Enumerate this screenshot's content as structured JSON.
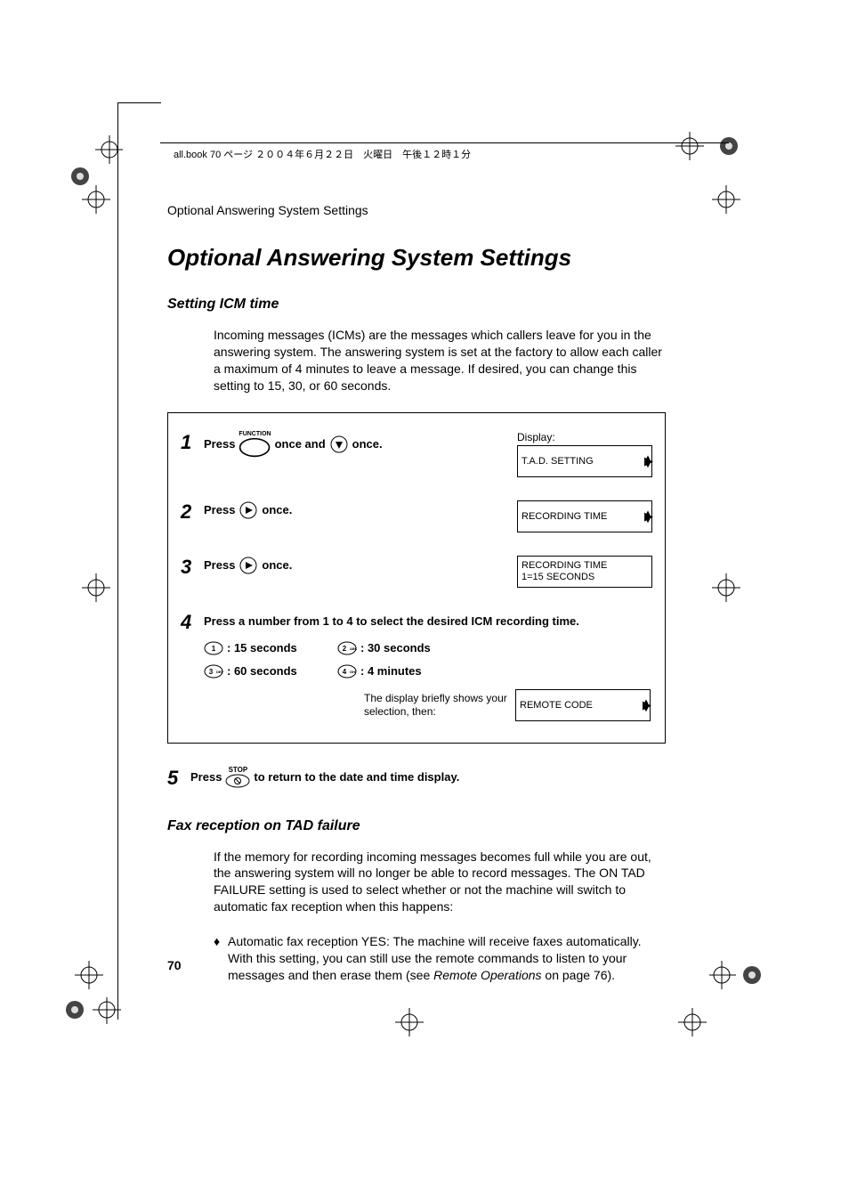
{
  "header": {
    "running_head": "Optional Answering System Settings",
    "book_line": "all.book  70 ページ  ２００４年６月２２日　火曜日　午後１２時１分"
  },
  "title": "Optional Answering System Settings",
  "section1": {
    "heading": "Setting ICM time",
    "para": "Incoming messages (ICMs) are the messages which callers leave for you in the answering system. The answering system is set at the factory to allow each caller a maximum of 4 minutes to leave a message. If desired, you can change this setting to 15, 30, or 60 seconds."
  },
  "steps": {
    "display_label": "Display:",
    "s1": {
      "num": "1",
      "press": "Press",
      "once_and": " once and ",
      "once": " once.",
      "display": "T.A.D. SETTING"
    },
    "s2": {
      "num": "2",
      "press": "Press ",
      "once": " once.",
      "display": "RECORDING TIME"
    },
    "s3": {
      "num": "3",
      "press": "Press ",
      "once": " once.",
      "display_l1": "RECORDING TIME",
      "display_l2": "1=15 SECONDS"
    },
    "s4": {
      "num": "4",
      "instr": "Press a number from 1 to 4 to select the desired ICM recording time.",
      "opt1": ": 15 seconds",
      "opt2": ": 30 seconds",
      "opt3": ":  60 seconds",
      "opt4": ": 4 minutes",
      "note": "The display briefly shows your selection, then:",
      "display": "REMOTE CODE"
    },
    "s5": {
      "num": "5",
      "press": "Press ",
      "rest": " to return to the date and time display."
    }
  },
  "section2": {
    "heading": "Fax reception on TAD failure",
    "para": "If the memory for recording incoming messages becomes full while you are out, the answering system will no longer be able to record messages. The ON TAD FAILURE setting is used to select whether or not the machine will switch to automatic fax reception when this happens:",
    "bullet_pre": "Automatic fax reception YES: The machine will receive faxes automatically. With this setting, you can still use the remote commands to listen to your messages and then erase them (see ",
    "bullet_ref": "Remote Operations",
    "bullet_post": " on page 76)."
  },
  "page_number": "70",
  "keys": {
    "k1": "1",
    "k2": "2ABC",
    "k3": "3DEF",
    "k4": "4GHI"
  },
  "icons": {
    "function": "FUNCTION",
    "stop": "STOP"
  }
}
